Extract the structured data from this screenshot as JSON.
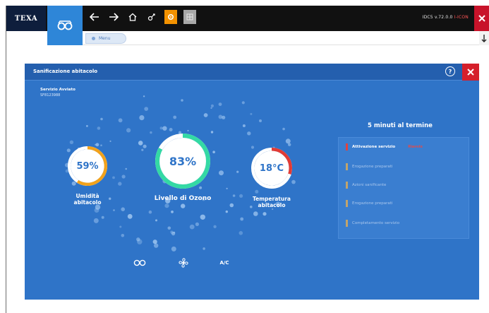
{
  "app": {
    "logo": "TEXA",
    "status_text": "IDC5 v.72.0.0",
    "status_alert": "I-ICON"
  },
  "nav": {
    "icons": [
      "back-arrow-icon",
      "forward-arrow-icon",
      "home-icon",
      "plug-icon",
      "gear-icon",
      "grid-icon"
    ],
    "breadcrumb": "Menu"
  },
  "dialog": {
    "title": "Sanificazione abitacolo",
    "service_label": "Servizio Avviato",
    "service_code": "SF8123988",
    "time_remaining": "5 minuti al termine",
    "gauges": [
      {
        "id": "humidity",
        "value": "59%",
        "percent": 59,
        "label_line1": "Umidità",
        "label_line2": "abitacolo",
        "color": "#f2a21b"
      },
      {
        "id": "ozone",
        "value": "83%",
        "percent": 83,
        "label_line1": "Livello di Ozono",
        "label_line2": "",
        "color": "#34d9a4"
      },
      {
        "id": "temperature",
        "value": "18°C",
        "percent": 30,
        "label_line1": "Temperatura",
        "label_line2": "abitacolo",
        "color": "#e23b35"
      }
    ],
    "steps": [
      {
        "label": "Attivazione servizio",
        "active": true,
        "extra": "Riavvio"
      },
      {
        "label": "Erogazione preparati",
        "active": false
      },
      {
        "label": "Azioni sanificante",
        "active": false
      },
      {
        "label": "Erogazione preparati",
        "active": false
      },
      {
        "label": "Completamento servizio",
        "active": false
      }
    ],
    "controls": [
      "car-view-icon",
      "fan-icon",
      "A/C"
    ]
  }
}
